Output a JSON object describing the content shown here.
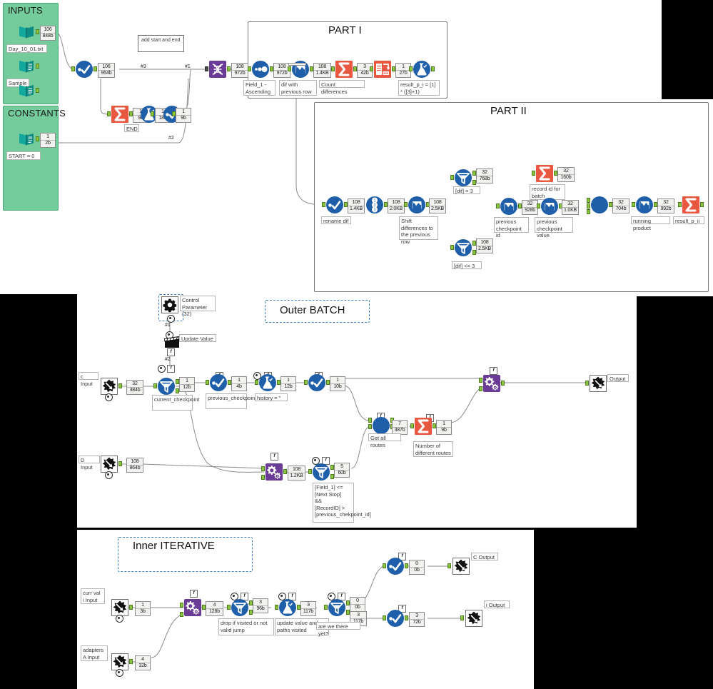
{
  "app": {
    "name": "Alteryx Designer Workflow Canvas",
    "background": "#000000"
  },
  "colors": {
    "container_green": "#74cc9c",
    "tool_blue": "#1f5fa9",
    "tool_red": "#e8573f",
    "tool_purple": "#6a3c96",
    "tool_teal": "#1f9e8f",
    "nub_green": "#8cc63e",
    "annotation_gray": "#3a3a3a",
    "dashed_blue": "#3f7fbf"
  },
  "containers": [
    {
      "id": "inputs",
      "title": "INPUTS"
    },
    {
      "id": "constants",
      "title": "CONSTANTS"
    }
  ],
  "title_boxes": [
    {
      "id": "part1",
      "title": "PART I"
    },
    {
      "id": "part2",
      "title": "PART II"
    },
    {
      "id": "outer",
      "title": "Outer BATCH"
    },
    {
      "id": "inner",
      "title": "Inner ITERATIVE"
    }
  ],
  "comments": [
    {
      "id": "add-start-end",
      "text": "add start and end"
    }
  ],
  "wire_labels": [
    {
      "id": "w3",
      "text": "#3"
    },
    {
      "id": "w1",
      "text": "#1"
    },
    {
      "id": "w2",
      "text": "#2"
    },
    {
      "id": "cp1",
      "text": "#1"
    },
    {
      "id": "cp2",
      "text": "#2"
    }
  ],
  "top_section": {
    "inputs": [
      {
        "name": "input-day-file",
        "icon": "input-data-icon",
        "label": "Day_10_01.txt",
        "records": "106",
        "size": "848b"
      },
      {
        "name": "input-unnamed",
        "icon": "input-data-icon",
        "label": "",
        "records": "",
        "size": ""
      },
      {
        "name": "input-sample",
        "icon": "text-input-icon",
        "label": "Sample",
        "records": "",
        "size": ""
      }
    ],
    "constants": [
      {
        "name": "input-start",
        "icon": "text-input-icon",
        "label": "START = 0",
        "records": "1",
        "size": "2b"
      }
    ],
    "nodes": [
      {
        "name": "union-tool",
        "icon": "union-icon",
        "label": "",
        "records": "106",
        "size": "954b"
      },
      {
        "name": "summarize-tool",
        "icon": "summarize-icon",
        "label": "",
        "records": "1",
        "size": "9b"
      },
      {
        "name": "formula-end",
        "icon": "formula-icon",
        "label": "END",
        "records": "1",
        "size": "18b"
      },
      {
        "name": "union-end",
        "icon": "union-icon",
        "label": "",
        "records": "1",
        "size": "9b"
      },
      {
        "name": "datacleanse-tool",
        "icon": "record-id-icon",
        "label": "",
        "records": "108",
        "size": "972b"
      }
    ]
  },
  "part1": {
    "nodes": [
      {
        "name": "sort-tool",
        "icon": "sort-icon",
        "label": "Field_1 - Ascending",
        "records": "108",
        "size": "972b"
      },
      {
        "name": "multirow-dif",
        "icon": "multi-row-icon",
        "label": "dif with previous row",
        "records": "108",
        "size": "1.4KB"
      },
      {
        "name": "summarize-count",
        "icon": "summarize-icon",
        "label": "Count differences",
        "records": "3",
        "size": "42b"
      },
      {
        "name": "crosstab-tool",
        "icon": "crosstab-icon",
        "label": "",
        "records": "1",
        "size": "27b"
      },
      {
        "name": "formula-result-pi",
        "icon": "formula-icon",
        "label": "result_p_i = [1] * ([3]+1)",
        "records": "",
        "size": ""
      }
    ]
  },
  "part2": {
    "nodes": [
      {
        "name": "select-rename-dif",
        "icon": "select-icon",
        "label": "rename dif",
        "records": "108",
        "size": "1.4KB"
      },
      {
        "name": "recordid-tool",
        "icon": "record-id2-icon",
        "label": "",
        "records": "108",
        "size": "2.0KB"
      },
      {
        "name": "multirow-shift",
        "icon": "multi-row-icon",
        "label": "Shift differences to the previous row",
        "records": "108",
        "size": "2.5KB"
      },
      {
        "name": "filter-dif-eq3",
        "icon": "filter-icon",
        "label": "[dif] = 3",
        "records": "32",
        "size": "768b"
      },
      {
        "name": "filter-dif-le3",
        "icon": "filter-icon",
        "label": "[dif] <= 3",
        "records": "108",
        "size": "2.5KB"
      },
      {
        "name": "summarize-recordid",
        "icon": "summarize-icon",
        "label": "record id for batch",
        "records": "32",
        "size": "160b"
      },
      {
        "name": "multirow-prev-id",
        "icon": "multi-row-icon",
        "label": "previous checkpoint id",
        "records": "32",
        "size": "928b"
      },
      {
        "name": "multirow-prev-val",
        "icon": "multi-row-icon",
        "label": "previous checkpoint value",
        "records": "32",
        "size": "1.0KB"
      },
      {
        "name": "join-multiple",
        "icon": "join-icon",
        "label": "",
        "records": "32",
        "size": "704b"
      },
      {
        "name": "multirow-running",
        "icon": "multi-row-icon",
        "label": "running product",
        "records": "32",
        "size": "992b"
      },
      {
        "name": "summarize-result-pii",
        "icon": "summarize-icon",
        "label": "result_p_ii",
        "records": "",
        "size": ""
      }
    ]
  },
  "outer_batch": {
    "control_parameter": {
      "name": "control-parameter",
      "icon": "gear-icon",
      "label": "Control Parameter (32)"
    },
    "action": {
      "name": "action-update-value",
      "icon": "action-icon",
      "label": "Update Value"
    },
    "nodes": [
      {
        "name": "macro-input-c",
        "icon": "macro-input-icon",
        "label": "c Input",
        "records": "32",
        "size": "384b"
      },
      {
        "name": "macro-input-d",
        "icon": "macro-input-icon",
        "label": "D Input",
        "records": "108",
        "size": "864b"
      },
      {
        "name": "filter-current-cp",
        "icon": "filter-icon",
        "label": "current_checkpoint",
        "records": "1",
        "size": "12b"
      },
      {
        "name": "select-prev-cp",
        "icon": "select-icon",
        "label": "previous_checkpoint",
        "records": "1",
        "size": "4b"
      },
      {
        "name": "formula-history",
        "icon": "formula-icon",
        "label": "history = ''",
        "records": "1",
        "size": "12b"
      },
      {
        "name": "select-tool-2",
        "icon": "select-icon",
        "label": "",
        "records": "1",
        "size": "10b"
      },
      {
        "name": "macro-iterative",
        "icon": "macro-icon",
        "label": "",
        "records": "108",
        "size": "1.2KB"
      },
      {
        "name": "filter-next-stop",
        "icon": "filter-icon",
        "label": "[Field_1] <= [Next Stop]\n&&\n[RecordID] > [previous_chekpoint_id]",
        "records": "5",
        "size": "60b"
      },
      {
        "name": "join-get-routes",
        "icon": "join-icon",
        "label": "Get all routes",
        "records": "7",
        "size": "387b"
      },
      {
        "name": "summarize-routes",
        "icon": "summarize-icon",
        "label": "Number of different routes",
        "records": "1",
        "size": "9b"
      },
      {
        "name": "macro-final",
        "icon": "macro-icon",
        "label": "",
        "records": "",
        "size": ""
      },
      {
        "name": "macro-output",
        "icon": "macro-output-icon",
        "label": "Output",
        "records": "",
        "size": ""
      }
    ]
  },
  "inner_iterative": {
    "nodes": [
      {
        "name": "macro-input-currval",
        "icon": "macro-input-icon",
        "label": "curr val\ni Input",
        "records": "1",
        "size": "3b"
      },
      {
        "name": "macro-input-adapters",
        "icon": "macro-input-icon",
        "label": "adapters\nA Input",
        "records": "4",
        "size": "32b"
      },
      {
        "name": "macro-joiner",
        "icon": "macro-icon",
        "label": "",
        "records": "4",
        "size": "128b"
      },
      {
        "name": "filter-drop-visited",
        "icon": "filter-icon",
        "label": "drop if visited or not valid jump",
        "records": "3",
        "size": "96b"
      },
      {
        "name": "formula-update",
        "icon": "formula-icon",
        "label": "update value and paths visited",
        "records": "3",
        "size": "117b"
      },
      {
        "name": "filter-there-yet",
        "icon": "filter-icon",
        "label": "are we there yet?",
        "records_t": "0",
        "size_t": "0b",
        "records_f": "3",
        "size_f": "117b"
      },
      {
        "name": "select-c-out",
        "icon": "select-icon",
        "label": "",
        "records": "0",
        "size": "0b"
      },
      {
        "name": "select-i-out",
        "icon": "select-icon",
        "label": "",
        "records": "3",
        "size": "72b"
      },
      {
        "name": "macro-output-c",
        "icon": "macro-output-icon",
        "label": "C Output",
        "records": "",
        "size": ""
      },
      {
        "name": "macro-output-i",
        "icon": "macro-output-icon",
        "label": "i Output",
        "records": "",
        "size": ""
      }
    ]
  }
}
